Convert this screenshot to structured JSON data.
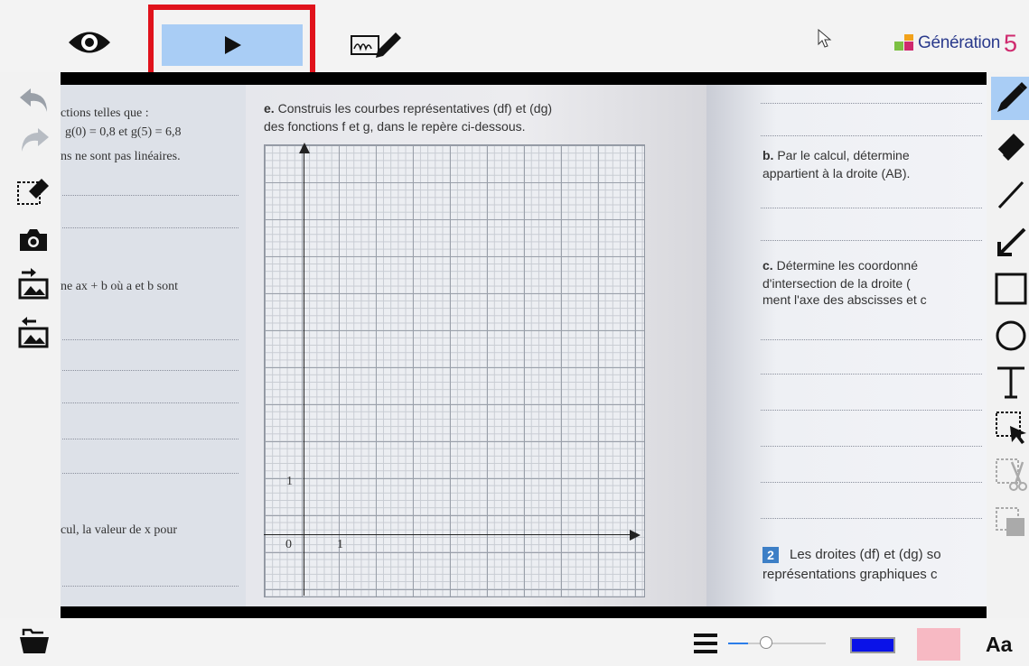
{
  "toolbar": {
    "items": [
      "eye-icon",
      "play-button",
      "signature-icon"
    ]
  },
  "logo": {
    "text": "Génération",
    "number": "5"
  },
  "document": {
    "left_page": {
      "lines": [
        "ctions telles que :",
        "g(0) = 0,8 et g(5) = 6,8",
        "ns ne sont pas linéaires.",
        "ne ax + b où a et b sont",
        "cul, la valeur de x pour"
      ]
    },
    "mid_page": {
      "heading_bold": "e.",
      "heading_line1": "Construis les courbes représentatives (df) et (dg)",
      "heading_line2": "des fonctions f et g, dans le repère ci-dessous.",
      "axis_labels": {
        "one_y": "1",
        "zero": "0",
        "one_x": "1"
      }
    },
    "right_page": {
      "b_bold": "b.",
      "b_line1": "Par le calcul, détermine",
      "b_line2": "appartient à la droite (AB).",
      "c_bold": "c.",
      "c_line1": "Détermine les coordonné",
      "c_line2": "d'intersection de la droite (",
      "c_line3": "ment l'axe des abscisses et c",
      "ex2_num": "2",
      "ex2_line1": "Les droites (df) et (dg) so",
      "ex2_line2": "représentations graphiques c"
    }
  },
  "left_tools": [
    "undo-icon",
    "redo-icon",
    "clear-annotations-icon",
    "camera-icon",
    "import-image-icon",
    "export-image-icon"
  ],
  "right_tools": [
    "pen-icon",
    "eraser-icon",
    "line-icon",
    "arrow-icon",
    "rectangle-icon",
    "circle-icon",
    "text-icon",
    "selection-icon",
    "cut-icon",
    "copy-icon"
  ],
  "bottom": {
    "font_button": "Aa",
    "colors": {
      "stroke": "#0a12e8",
      "fill": "#f7b9c3"
    },
    "slider_value": 0.2
  }
}
